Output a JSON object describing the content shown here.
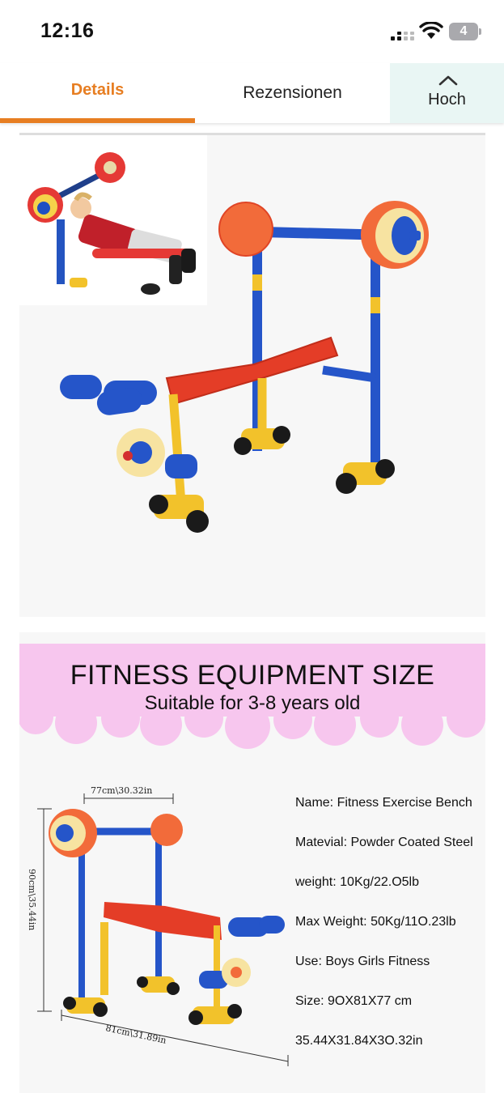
{
  "status": {
    "time": "12:16",
    "battery": "4"
  },
  "tabs": {
    "details": "Details",
    "reviews": "Rezensionen",
    "top": "Hoch"
  },
  "colors": {
    "accent": "#e77e22",
    "top_tab_bg": "#e9f6f4",
    "banner_pink": "#f7c6ee"
  },
  "icons": [
    "signal-icon",
    "wifi-icon",
    "battery-icon",
    "chevron-up-icon"
  ],
  "product_image_2": {
    "title": "FITNESS EQUIPMENT SIZE",
    "subtitle": "Suitable for 3-8 years old",
    "dimensions": {
      "width_label": "77cm\\30.32in",
      "height_label": "90cm\\35.44in",
      "depth_label": "81cm\\31.89in"
    },
    "specs": [
      "Name: Fitness Exercise Bench",
      "Matevial: Powder Coated Steel",
      "weight: 10Kg/22.O5lb",
      "Max Weight: 50Kg/11O.23lb",
      "Use: Boys Girls Fitness",
      "Size: 9OX81X77 cm",
      "35.44X31.84X3O.32in"
    ]
  }
}
